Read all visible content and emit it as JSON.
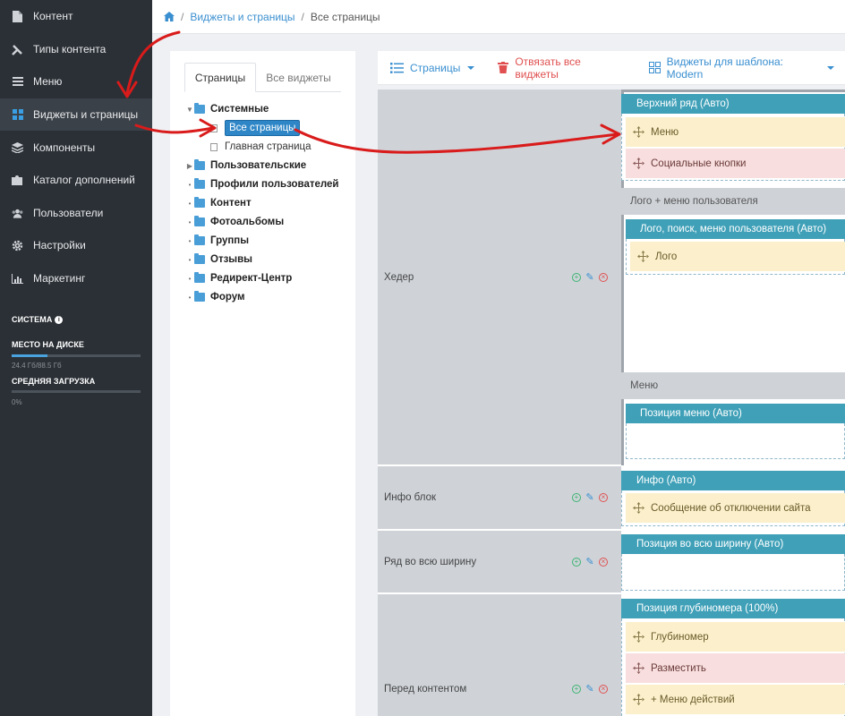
{
  "sidebar": {
    "items": [
      {
        "label": "Контент",
        "icon": "file-icon"
      },
      {
        "label": "Типы контента",
        "icon": "wrench-icon"
      },
      {
        "label": "Меню",
        "icon": "bars-icon"
      },
      {
        "label": "Виджеты и страницы",
        "icon": "grid-icon"
      },
      {
        "label": "Компоненты",
        "icon": "layers-icon"
      },
      {
        "label": "Каталог дополнений",
        "icon": "puzzle-icon"
      },
      {
        "label": "Пользователи",
        "icon": "users-icon"
      },
      {
        "label": "Настройки",
        "icon": "gear-icon"
      },
      {
        "label": "Маркетинг",
        "icon": "chart-icon"
      }
    ],
    "active_index": 3,
    "system_title": "СИСТЕМА",
    "disk_label": "МЕСТО НА ДИСКЕ",
    "disk_value": "24.4 Гб/88.5 Гб",
    "disk_fraction": 0.28,
    "load_label": "СРЕДНЯЯ ЗАГРУЗКА",
    "load_value": "0%",
    "load_fraction": 0.0
  },
  "breadcrumb": {
    "home_icon": "home-icon",
    "items": [
      "Виджеты и страницы",
      "Все страницы"
    ]
  },
  "left_panel": {
    "tabs": [
      "Страницы",
      "Все виджеты"
    ],
    "tree": [
      {
        "label": "Системные",
        "type": "folder",
        "expanded": true
      },
      {
        "label": "Все страницы",
        "type": "page",
        "selected": true
      },
      {
        "label": "Главная страница",
        "type": "page"
      },
      {
        "label": "Пользовательские",
        "type": "folder",
        "collapsed": true
      },
      {
        "label": "Профили пользователей",
        "type": "folder"
      },
      {
        "label": "Контент",
        "type": "folder"
      },
      {
        "label": "Фотоальбомы",
        "type": "folder"
      },
      {
        "label": "Группы",
        "type": "folder"
      },
      {
        "label": "Отзывы",
        "type": "folder"
      },
      {
        "label": "Редирект-Центр",
        "type": "folder"
      },
      {
        "label": "Форум",
        "type": "folder"
      }
    ]
  },
  "toolbar": {
    "pages_label": "Страницы",
    "unbind_label": "Отвязать все виджеты",
    "template_label": "Виджеты для шаблона: Modern"
  },
  "positions": [
    {
      "name": "Хедер"
    },
    {
      "name": "Инфо блок"
    },
    {
      "name": "Ряд во всю ширину"
    },
    {
      "name": "Перед контентом"
    }
  ],
  "layout": {
    "top_row_title": "Верхний ряд (Авто)",
    "top_row_widgets": [
      {
        "label": "Меню",
        "color": "yellow"
      },
      {
        "label": "Социальные кнопки",
        "color": "pink"
      }
    ],
    "logo_caption": "Лого + меню пользователя",
    "logo_title": "Лого, поиск, меню пользователя (Авто)",
    "logo_widgets": [
      {
        "label": "Лого",
        "color": "yellow"
      }
    ],
    "menu_caption": "Меню",
    "menu_title": "Позиция меню (Авто)",
    "info_title": "Инфо (Авто)",
    "info_widgets": [
      {
        "label": "Сообщение об отключении сайта",
        "color": "yellow"
      }
    ],
    "full_title": "Позиция во всю ширину (Авто)",
    "depth_title": "Позиция глубиномера (100%)",
    "depth_widgets": [
      {
        "label": "Глубиномер",
        "color": "yellow"
      },
      {
        "label": "Разместить",
        "color": "pink"
      },
      {
        "label": "+ Меню действий",
        "color": "yellow"
      }
    ]
  },
  "colors": {
    "sidebar_bg": "#2b3036",
    "accent": "#3a8fd0",
    "block_title": "#3fa0b8",
    "danger": "#e05050",
    "annotation": "#d91b1b"
  }
}
